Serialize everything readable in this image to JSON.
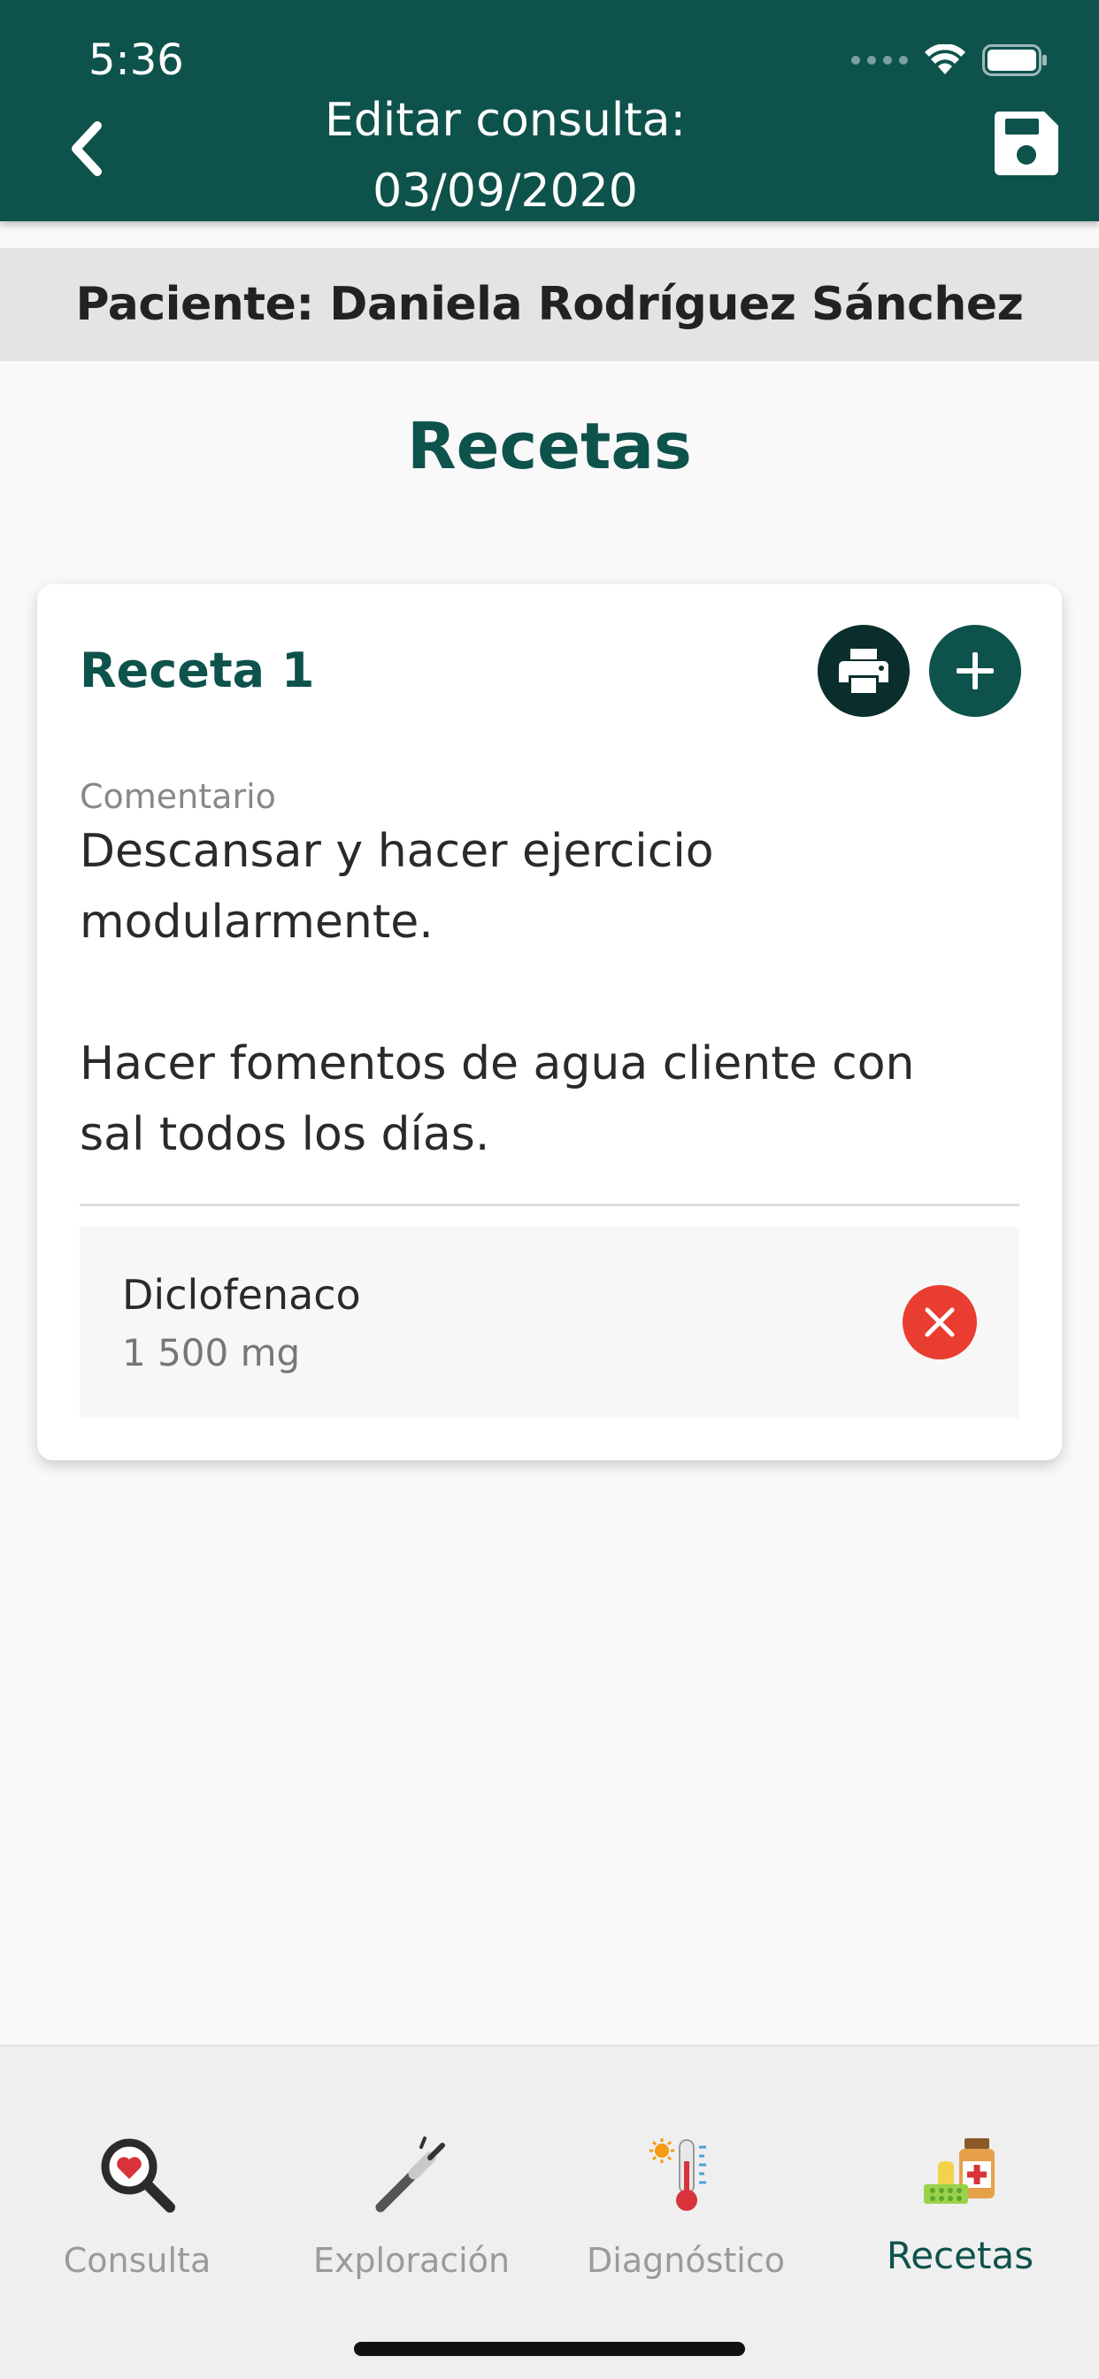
{
  "status_bar": {
    "time": "5:36"
  },
  "header": {
    "title_line1": "Editar consulta:",
    "title_line2": "03/09/2020"
  },
  "patient": {
    "label": "Paciente: Daniela Rodríguez Sánchez"
  },
  "section_title": "Recetas",
  "recipe": {
    "title": "Receta 1",
    "comment_label": "Comentario",
    "comment_text": "Descansar y hacer ejercicio\nmodularmente.\n\nHacer fomentos de agua cliente con\nsal todos los días.",
    "medications": [
      {
        "name": "Diclofenaco",
        "dose": "1 500 mg"
      }
    ]
  },
  "bottom_nav": {
    "items": [
      {
        "label": "Consulta",
        "icon": "magnifier-heart-icon",
        "active": false
      },
      {
        "label": "Exploración",
        "icon": "otoscope-icon",
        "active": false
      },
      {
        "label": "Diagnóstico",
        "icon": "thermometer-icon",
        "active": false
      },
      {
        "label": "Recetas",
        "icon": "medicine-icon",
        "active": true
      }
    ]
  },
  "colors": {
    "primary": "#0e524c",
    "print_button": "#0a2e2b",
    "remove_button": "#ea3d32",
    "patient_bar": "#e4e4e4"
  }
}
